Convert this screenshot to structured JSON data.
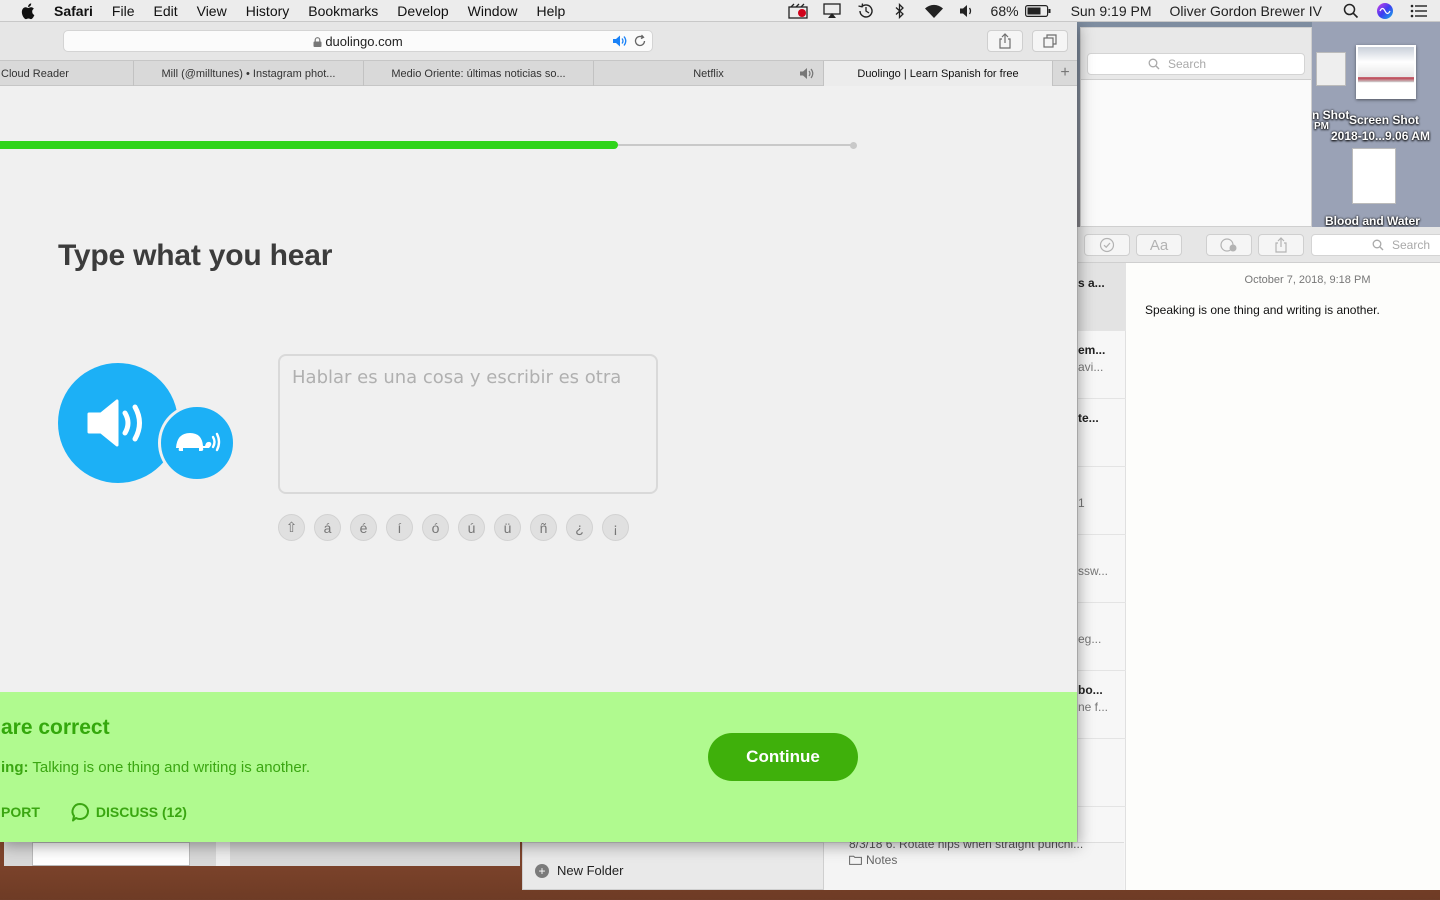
{
  "menubar": {
    "app_name": "Safari",
    "items": [
      "File",
      "Edit",
      "View",
      "History",
      "Bookmarks",
      "Develop",
      "Window",
      "Help"
    ],
    "battery": "68%",
    "clock": "Sun 9:19 PM",
    "user": "Oliver Gordon Brewer IV",
    "status_icons": [
      "screen-recording-icon",
      "airplay-icon",
      "time-machine-icon",
      "bluetooth-icon",
      "wifi-icon",
      "volume-icon",
      "battery-icon",
      "spotlight-icon",
      "siri-icon",
      "notification-center-icon"
    ]
  },
  "safari": {
    "url": "duolingo.com",
    "tabs": [
      {
        "label": "Cloud Reader"
      },
      {
        "label": "Mill (@milltunes) • Instagram phot..."
      },
      {
        "label": "Medio Oriente: últimas noticias so..."
      },
      {
        "label": "Netflix"
      },
      {
        "label": "Duolingo | Learn Spanish for free"
      }
    ]
  },
  "lesson": {
    "progress_fraction": 0.724,
    "title": "Type what you hear",
    "answer_text": "Hablar es una cosa y escribir es otra",
    "accent_keys": [
      "⇧",
      "á",
      "é",
      "í",
      "ó",
      "ú",
      "ü",
      "ñ",
      "¿",
      "¡"
    ],
    "feedback": {
      "title": "are correct",
      "meaning_label": "ing:",
      "meaning_text": "Talking is one thing and writing is another.",
      "report_label": "PORT",
      "discuss_label": "DISCUSS (12)",
      "continue_label": "Continue"
    },
    "colors": {
      "accent_blue": "#1cb0f6",
      "progress_green": "#2fd41a",
      "feedback_bg": "#b0fa8f",
      "continue_green": "#3fb00b"
    }
  },
  "finder": {
    "search_placeholder": "Search"
  },
  "desktop": {
    "screenshot_label_1": "Screen Shot",
    "screenshot_label_2": "2018-10...9.06 AM",
    "partial_label": "n Shot",
    "partial_label_2": "PM",
    "doc_label": "Blood and Water"
  },
  "notes": {
    "search_placeholder": "Search",
    "list": [
      {
        "title": "s a...",
        "snippet": ""
      },
      {
        "title": "em...",
        "snippet": "avi..."
      },
      {
        "title": "te...",
        "snippet": ""
      },
      {
        "title": "1",
        "snippet": ""
      },
      {
        "title": "",
        "snippet": "ssw..."
      },
      {
        "title": "",
        "snippet": "eg..."
      },
      {
        "title": "bo...",
        "snippet": "ne f..."
      }
    ],
    "date": "October 7, 2018, 9:18 PM",
    "body": "Speaking is one thing and writing is another.",
    "peek_line1": "8/3/18  6. Rotate hips when straight punchi...",
    "peek_folder": "Notes",
    "new_folder": "New Folder"
  }
}
